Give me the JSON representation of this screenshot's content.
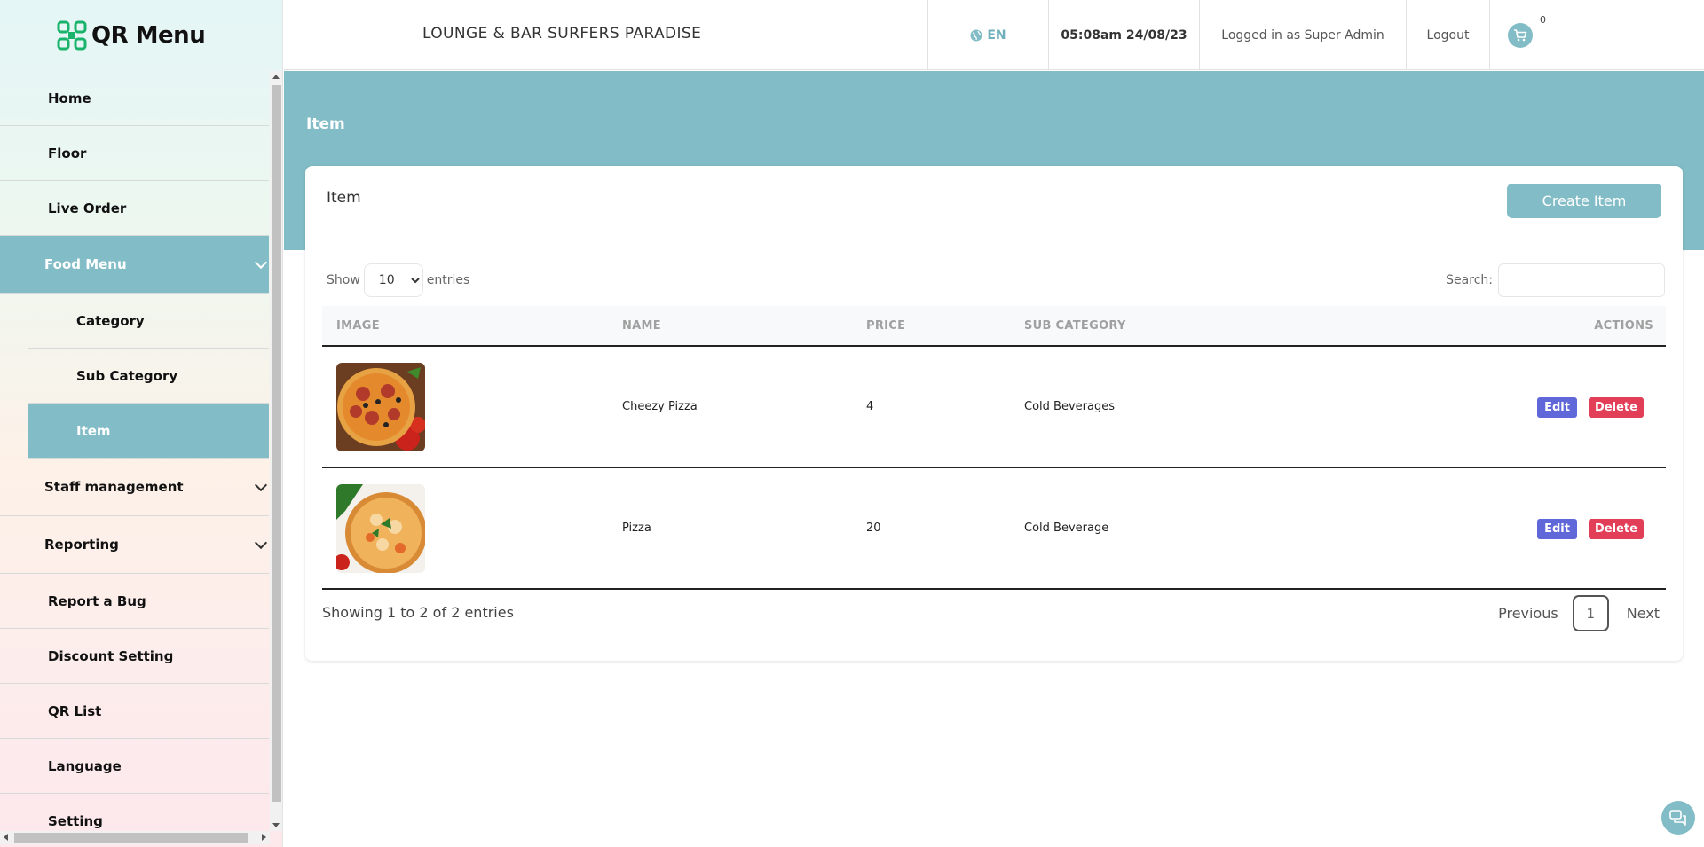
{
  "app": {
    "logo_text": "QR Menu"
  },
  "sidebar": {
    "items": [
      {
        "label": "Home"
      },
      {
        "label": "Floor"
      },
      {
        "label": "Live Order"
      },
      {
        "label": "Food Menu"
      },
      {
        "label": "Category"
      },
      {
        "label": "Sub Category"
      },
      {
        "label": "Item"
      },
      {
        "label": "Staff management"
      },
      {
        "label": "Reporting"
      },
      {
        "label": "Report a Bug"
      },
      {
        "label": "Discount Setting"
      },
      {
        "label": "QR List"
      },
      {
        "label": "Language"
      },
      {
        "label": "Setting"
      }
    ]
  },
  "header": {
    "title": "LOUNGE & BAR SURFERS PARADISE",
    "language": "EN",
    "datetime": "05:08am 24/08/23",
    "user": "Logged in as Super Admin",
    "logout": "Logout",
    "cart_count": "0"
  },
  "page": {
    "banner_title": "Item",
    "card_title": "Item",
    "create_button": "Create Item",
    "show_label": "Show",
    "entries_label": "entries",
    "page_length": "10",
    "search_label": "Search:",
    "search_value": ""
  },
  "table": {
    "columns": [
      "IMAGE",
      "NAME",
      "PRICE",
      "SUB CATEGORY",
      "ACTIONS"
    ],
    "rows": [
      {
        "name": "Cheezy Pizza",
        "price": "4",
        "sub_category": "Cold Beverages",
        "edit": "Edit",
        "delete": "Delete"
      },
      {
        "name": "Pizza",
        "price": "20",
        "sub_category": "Cold Beverage",
        "edit": "Edit",
        "delete": "Delete"
      }
    ],
    "info": "Showing 1 to 2 of 2 entries",
    "pagination": {
      "previous": "Previous",
      "current": "1",
      "next": "Next"
    }
  },
  "colors": {
    "accent": "#82bcc6",
    "edit": "#5f67d9",
    "delete": "#e23e57"
  }
}
